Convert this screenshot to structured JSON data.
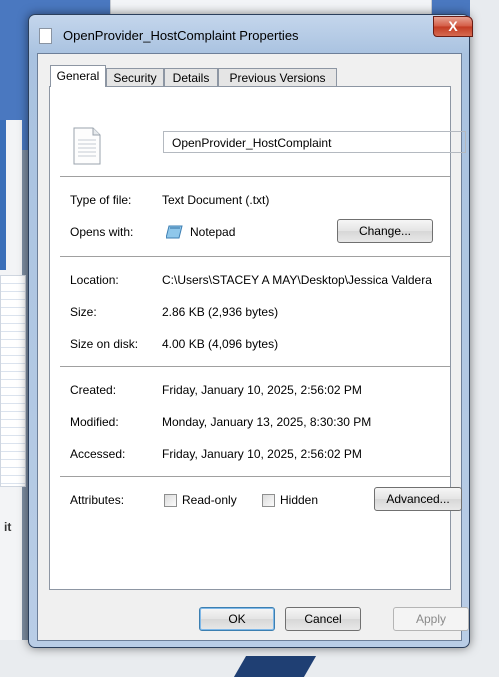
{
  "window": {
    "title": "OpenProvider_HostComplaint Properties",
    "close_label": "X"
  },
  "tabs": [
    {
      "label": "General",
      "active": true
    },
    {
      "label": "Security",
      "active": false
    },
    {
      "label": "Details",
      "active": false
    },
    {
      "label": "Previous Versions",
      "active": false
    }
  ],
  "general": {
    "file_name": "OpenProvider_HostComplaint",
    "file_icon": "text-document-icon",
    "type_label": "Type of file:",
    "type_value": "Text Document (.txt)",
    "opens_label": "Opens with:",
    "opens_value": "Notepad",
    "opens_icon": "notepad-icon",
    "change_button": "Change...",
    "location_label": "Location:",
    "location_value": "C:\\Users\\STACEY A MAY\\Desktop\\Jessica Valdera",
    "size_label": "Size:",
    "size_value": "2.86 KB (2,936 bytes)",
    "size_disk_label": "Size on disk:",
    "size_disk_value": "4.00 KB (4,096 bytes)",
    "created_label": "Created:",
    "created_value": "Friday, January 10, 2025, 2:56:02 PM",
    "modified_label": "Modified:",
    "modified_value": "Monday, January 13, 2025, 8:30:30 PM",
    "accessed_label": "Accessed:",
    "accessed_value": "Friday, January 10, 2025, 2:56:02 PM",
    "attributes_label": "Attributes:",
    "readonly_label": "Read-only",
    "readonly_checked": false,
    "hidden_label": "Hidden",
    "hidden_checked": false,
    "advanced_button": "Advanced..."
  },
  "footer": {
    "ok": "OK",
    "cancel": "Cancel",
    "apply": "Apply",
    "apply_enabled": false
  },
  "background": {
    "fragment_text": "it"
  }
}
